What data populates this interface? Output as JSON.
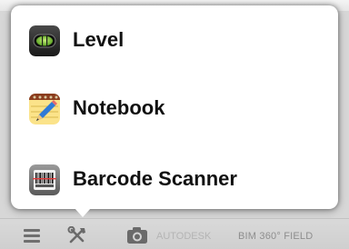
{
  "menu": {
    "items": [
      {
        "label": "Level",
        "icon": "level-app-icon"
      },
      {
        "label": "Notebook",
        "icon": "notebook-app-icon"
      },
      {
        "label": "Barcode Scanner",
        "icon": "barcode-scanner-app-icon"
      }
    ]
  },
  "toolbar": {
    "brand_text": "AUTODESK",
    "product_text": "BIM 360° FIELD",
    "icons": [
      "menu-icon",
      "tools-icon",
      "camera-icon"
    ]
  },
  "colors": {
    "menu_background": "#ffffff",
    "toolbar_background": "#d4d4d4",
    "label_text": "#111111",
    "icon_gray": "#6f6f6f"
  }
}
